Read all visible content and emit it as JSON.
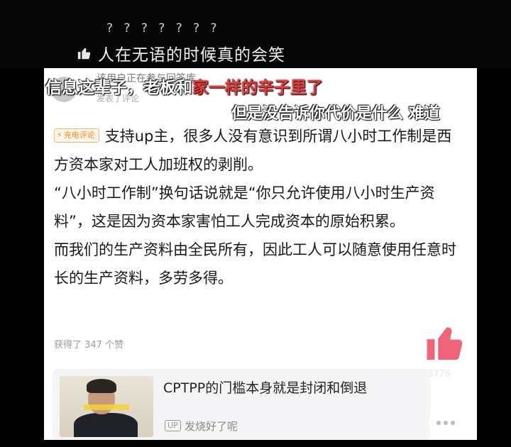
{
  "top": {
    "qmarks": "? ? ? ? ? ? ?",
    "headline": "人在无语的时候真的会笑"
  },
  "comment_header": {
    "user_line": "该用户正在参与回答库",
    "time_line": "发表了评论"
  },
  "danmaku": {
    "line1_white": "信息这辈子，老板和",
    "line1_red": "家一样的辛子里了",
    "line2": "但是没告诉你代价是什么  难道"
  },
  "comment": {
    "badge_label": "充电评论",
    "paragraphs": [
      "支持up主，很多人没有意识到所谓八小时工作制是西方资本家对工人加班权的剥削。",
      "“八小时工作制”换句话说就是“你只允许使用八小时生产资料”，这是因为资本家害怕工人完成资本的原始积累。",
      "而我们的生产资料由全民所有，因此工人可以随意使用任意时长的生产资料，多劳多得。"
    ],
    "likes_text": "获得了 347 个赞"
  },
  "actions": {
    "like_count": "8776"
  },
  "video": {
    "title": "CPTPP的门槛本身就是封闭和倒退",
    "up_badge": "UP",
    "uploader": "发烧好了呢"
  },
  "colors": {
    "like_pink": "#f0647a",
    "badge_orange": "#f08a1c",
    "danmaku_red": "#e23b3b"
  }
}
